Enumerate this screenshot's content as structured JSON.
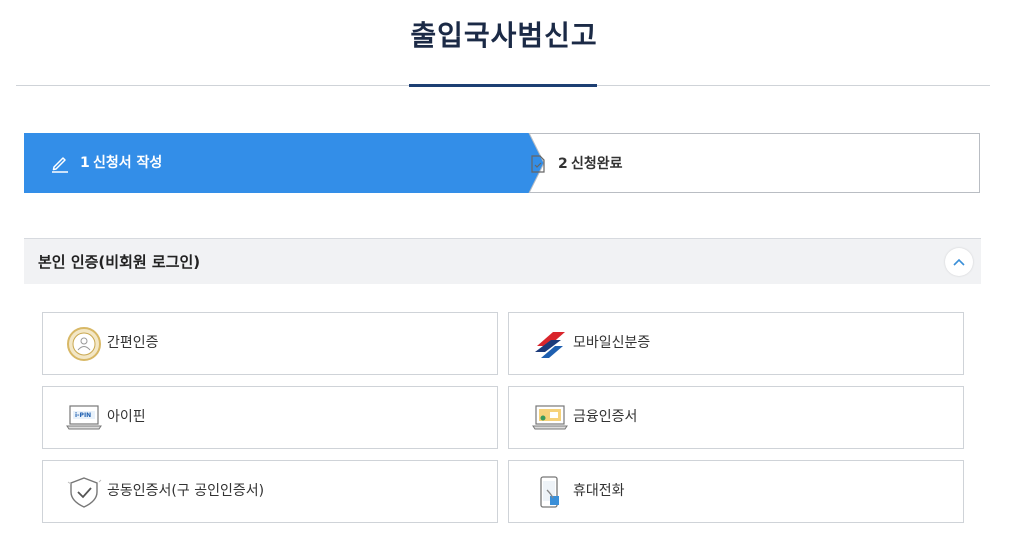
{
  "page": {
    "title": "출입국사범신고"
  },
  "steps": [
    {
      "number": "1",
      "label": "신청서 작성",
      "state": "active"
    },
    {
      "number": "2",
      "label": "신청완료",
      "state": "inactive"
    }
  ],
  "section": {
    "title": "본인 인증(비회원 로그인)"
  },
  "auth_options": [
    {
      "label": "간편인증",
      "icon": "simple-auth-icon"
    },
    {
      "label": "모바일신분증",
      "icon": "mobile-id-icon"
    },
    {
      "label": "아이핀",
      "icon": "ipin-icon",
      "icon_text": "i-PIN"
    },
    {
      "label": "금융인증서",
      "icon": "finance-cert-icon"
    },
    {
      "label": "공동인증서(구 공인인증서)",
      "icon": "joint-cert-icon"
    },
    {
      "label": "휴대전화",
      "icon": "mobile-phone-icon"
    }
  ],
  "colors": {
    "accent": "#338ee8",
    "title_underline": "#1d3f73",
    "section_bg": "#f1f2f4"
  }
}
